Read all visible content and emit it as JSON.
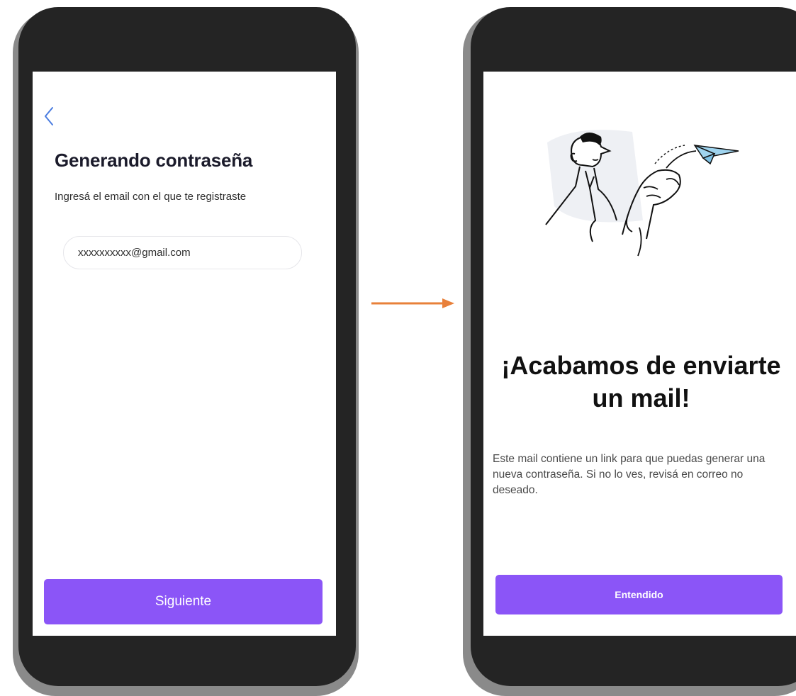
{
  "screen1": {
    "back_icon": "chevron-left-icon",
    "title": "Generando contraseña",
    "subtitle": "Ingresá el email con el que te registraste",
    "email_value": "xxxxxxxxxx@gmail.com",
    "next_label": "Siguiente"
  },
  "arrow": {
    "icon": "arrow-right-icon",
    "color": "#e8803a"
  },
  "screen2": {
    "illustration": "paper-plane-illustration",
    "title_line1": "¡Acabamos de enviarte",
    "title_line2": "un mail!",
    "body": "Este mail contiene un link para que puedas generar una nueva contraseña. Si no lo ves, revisá en correo no deseado.",
    "ok_label": "Entendido"
  },
  "colors": {
    "accent": "#8b55f7",
    "phone_frame": "#242424",
    "link": "#4a7ce0",
    "plane": "#9fd4ef"
  }
}
